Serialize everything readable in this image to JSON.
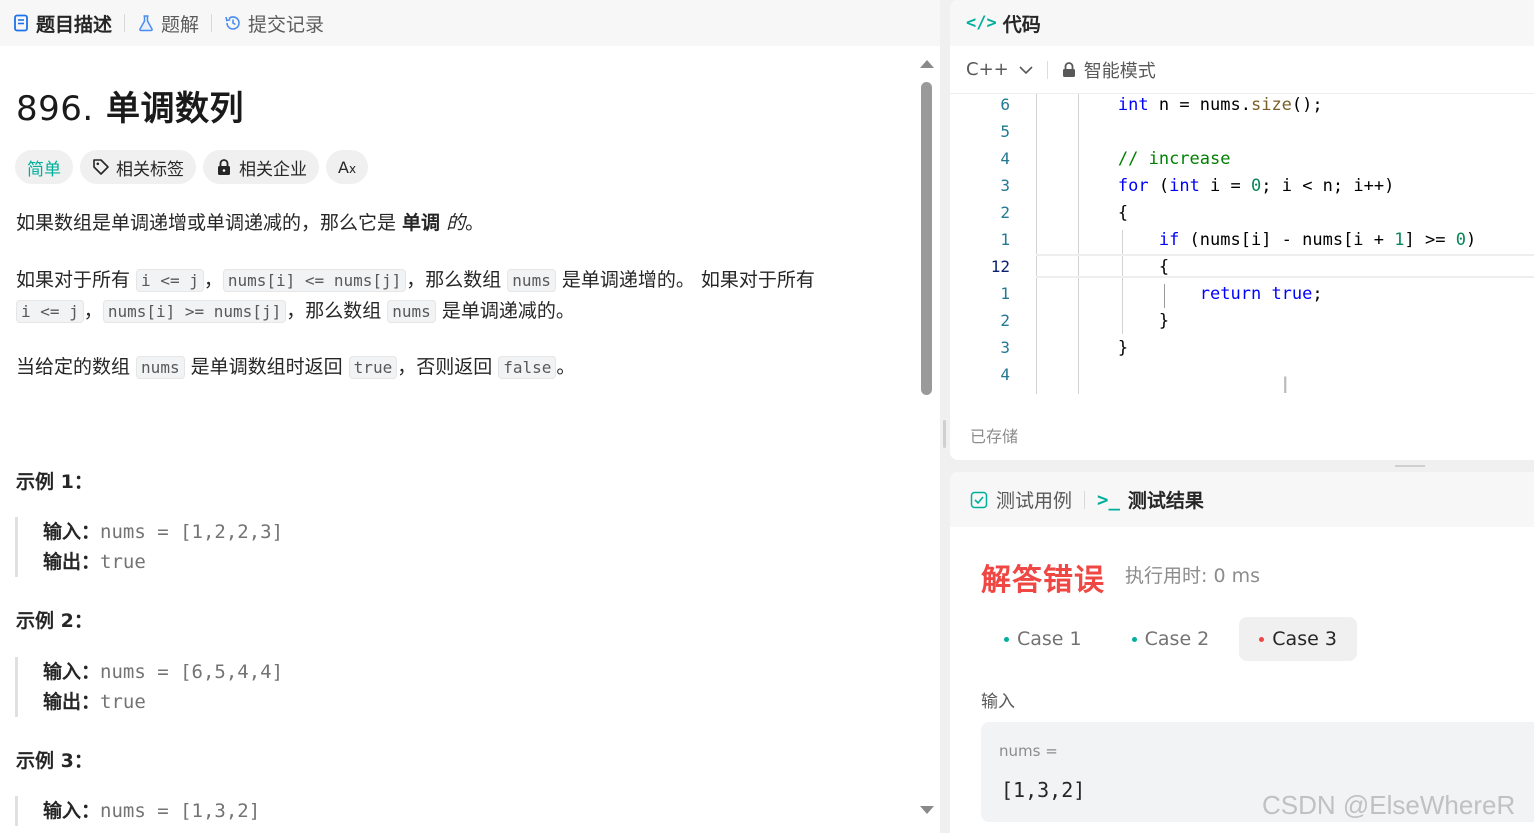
{
  "left_tabs": [
    {
      "label": "题目描述",
      "icon": "doc-icon"
    },
    {
      "label": "题解",
      "icon": "flask-icon"
    },
    {
      "label": "提交记录",
      "icon": "history-icon"
    }
  ],
  "problem": {
    "number": "896.",
    "title": "单调数列",
    "tags": {
      "difficulty": "简单",
      "topics": "相关标签",
      "companies": "相关企业",
      "translate": "Aあ"
    },
    "p1": {
      "a": "如果数组是单调递增或单调递减的，那么它是 ",
      "b": "单调",
      "c": "的",
      "d": "。"
    },
    "p2": {
      "t1": "如果对于所有 ",
      "c1": "i <= j",
      "t2": "，",
      "c2": "nums[i] <= nums[j]",
      "t3": "，那么数组 ",
      "c3": "nums",
      "t4": " 是单调递增的。 如果对于所有 ",
      "c4": "i <= j",
      "t5": "，",
      "c5": "nums[i] >= nums[j]",
      "t6": "，那么数组 ",
      "c6": "nums",
      "t7": " 是单调递减的。"
    },
    "p3": {
      "t1": "当给定的数组 ",
      "c1": "nums",
      "t2": " 是单调数组时返回 ",
      "c2": "true",
      "t3": "，否则返回 ",
      "c3": "false",
      "t4": "。"
    }
  },
  "examples": [
    {
      "title": "示例 1：",
      "input_label": "输入：",
      "input": "nums = [1,2,2,3]",
      "output_label": "输出：",
      "output": "true"
    },
    {
      "title": "示例 2：",
      "input_label": "输入：",
      "input": "nums = [6,5,4,4]",
      "output_label": "输出：",
      "output": "true"
    },
    {
      "title": "示例 3：",
      "input_label": "输入：",
      "input": "nums = [1,3,2]"
    }
  ],
  "code_panel": {
    "title": "代码",
    "language": "C++",
    "mode": "智能模式",
    "saved": "已存储",
    "line_numbers": [
      "6",
      "5",
      "4",
      "3",
      "2",
      "1",
      "12",
      "1",
      "2",
      "3",
      "4"
    ]
  },
  "result_panel": {
    "tabs": [
      "测试用例",
      "测试结果"
    ],
    "verdict": "解答错误",
    "runtime": "执行用时: 0 ms",
    "cases": [
      "Case 1",
      "Case 2",
      "Case 3"
    ],
    "input_label": "输入",
    "input_name": "nums =",
    "input_value": "[1,3,2]"
  },
  "watermark": "CSDN @ElseWhereR",
  "colors": {
    "accent": "#00af9b",
    "error": "#ef4743"
  }
}
